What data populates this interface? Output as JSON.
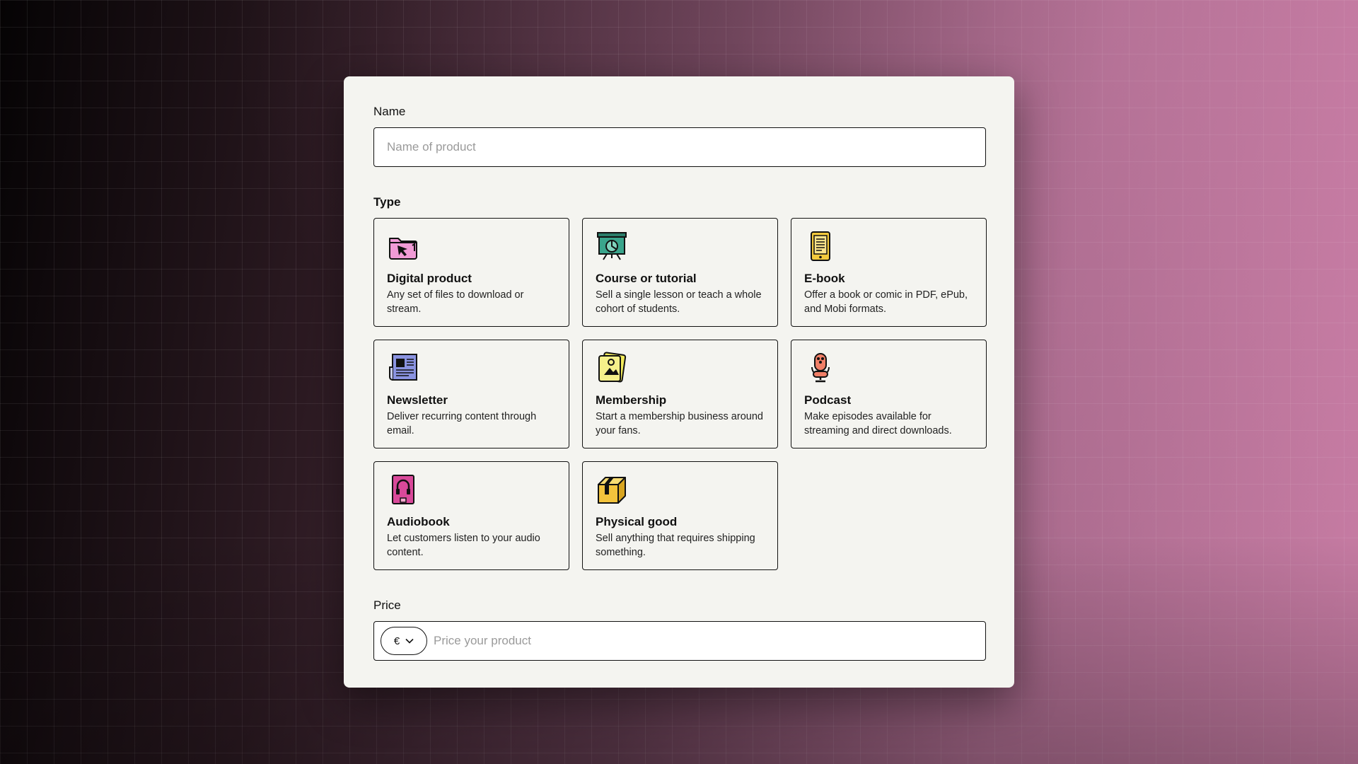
{
  "form": {
    "name_label": "Name",
    "name_placeholder": "Name of product",
    "type_label": "Type",
    "price_label": "Price",
    "price_placeholder": "Price your product",
    "currency": "€"
  },
  "types": [
    {
      "title": "Digital product",
      "description": "Any set of files to download or stream.",
      "icon": "folder-cursor-icon",
      "color": "#f19bd6"
    },
    {
      "title": "Course or tutorial",
      "description": "Sell a single lesson or teach a whole cohort of students.",
      "icon": "presentation-board-icon",
      "color": "#3aa58c"
    },
    {
      "title": "E-book",
      "description": "Offer a book or comic in PDF, ePub, and Mobi formats.",
      "icon": "ebook-reader-icon",
      "color": "#f3c93c"
    },
    {
      "title": "Newsletter",
      "description": "Deliver recurring content through email.",
      "icon": "newspaper-icon",
      "color": "#8a93e0"
    },
    {
      "title": "Membership",
      "description": "Start a membership business around your fans.",
      "icon": "membership-card-icon",
      "color": "#f1ea5a"
    },
    {
      "title": "Podcast",
      "description": "Make episodes available for streaming and direct downloads.",
      "icon": "microphone-icon",
      "color": "#f07f67"
    },
    {
      "title": "Audiobook",
      "description": "Let customers listen to your audio content.",
      "icon": "headphones-book-icon",
      "color": "#d9499a"
    },
    {
      "title": "Physical good",
      "description": "Sell anything that requires shipping something.",
      "icon": "package-box-icon",
      "color": "#f3c33c"
    }
  ]
}
